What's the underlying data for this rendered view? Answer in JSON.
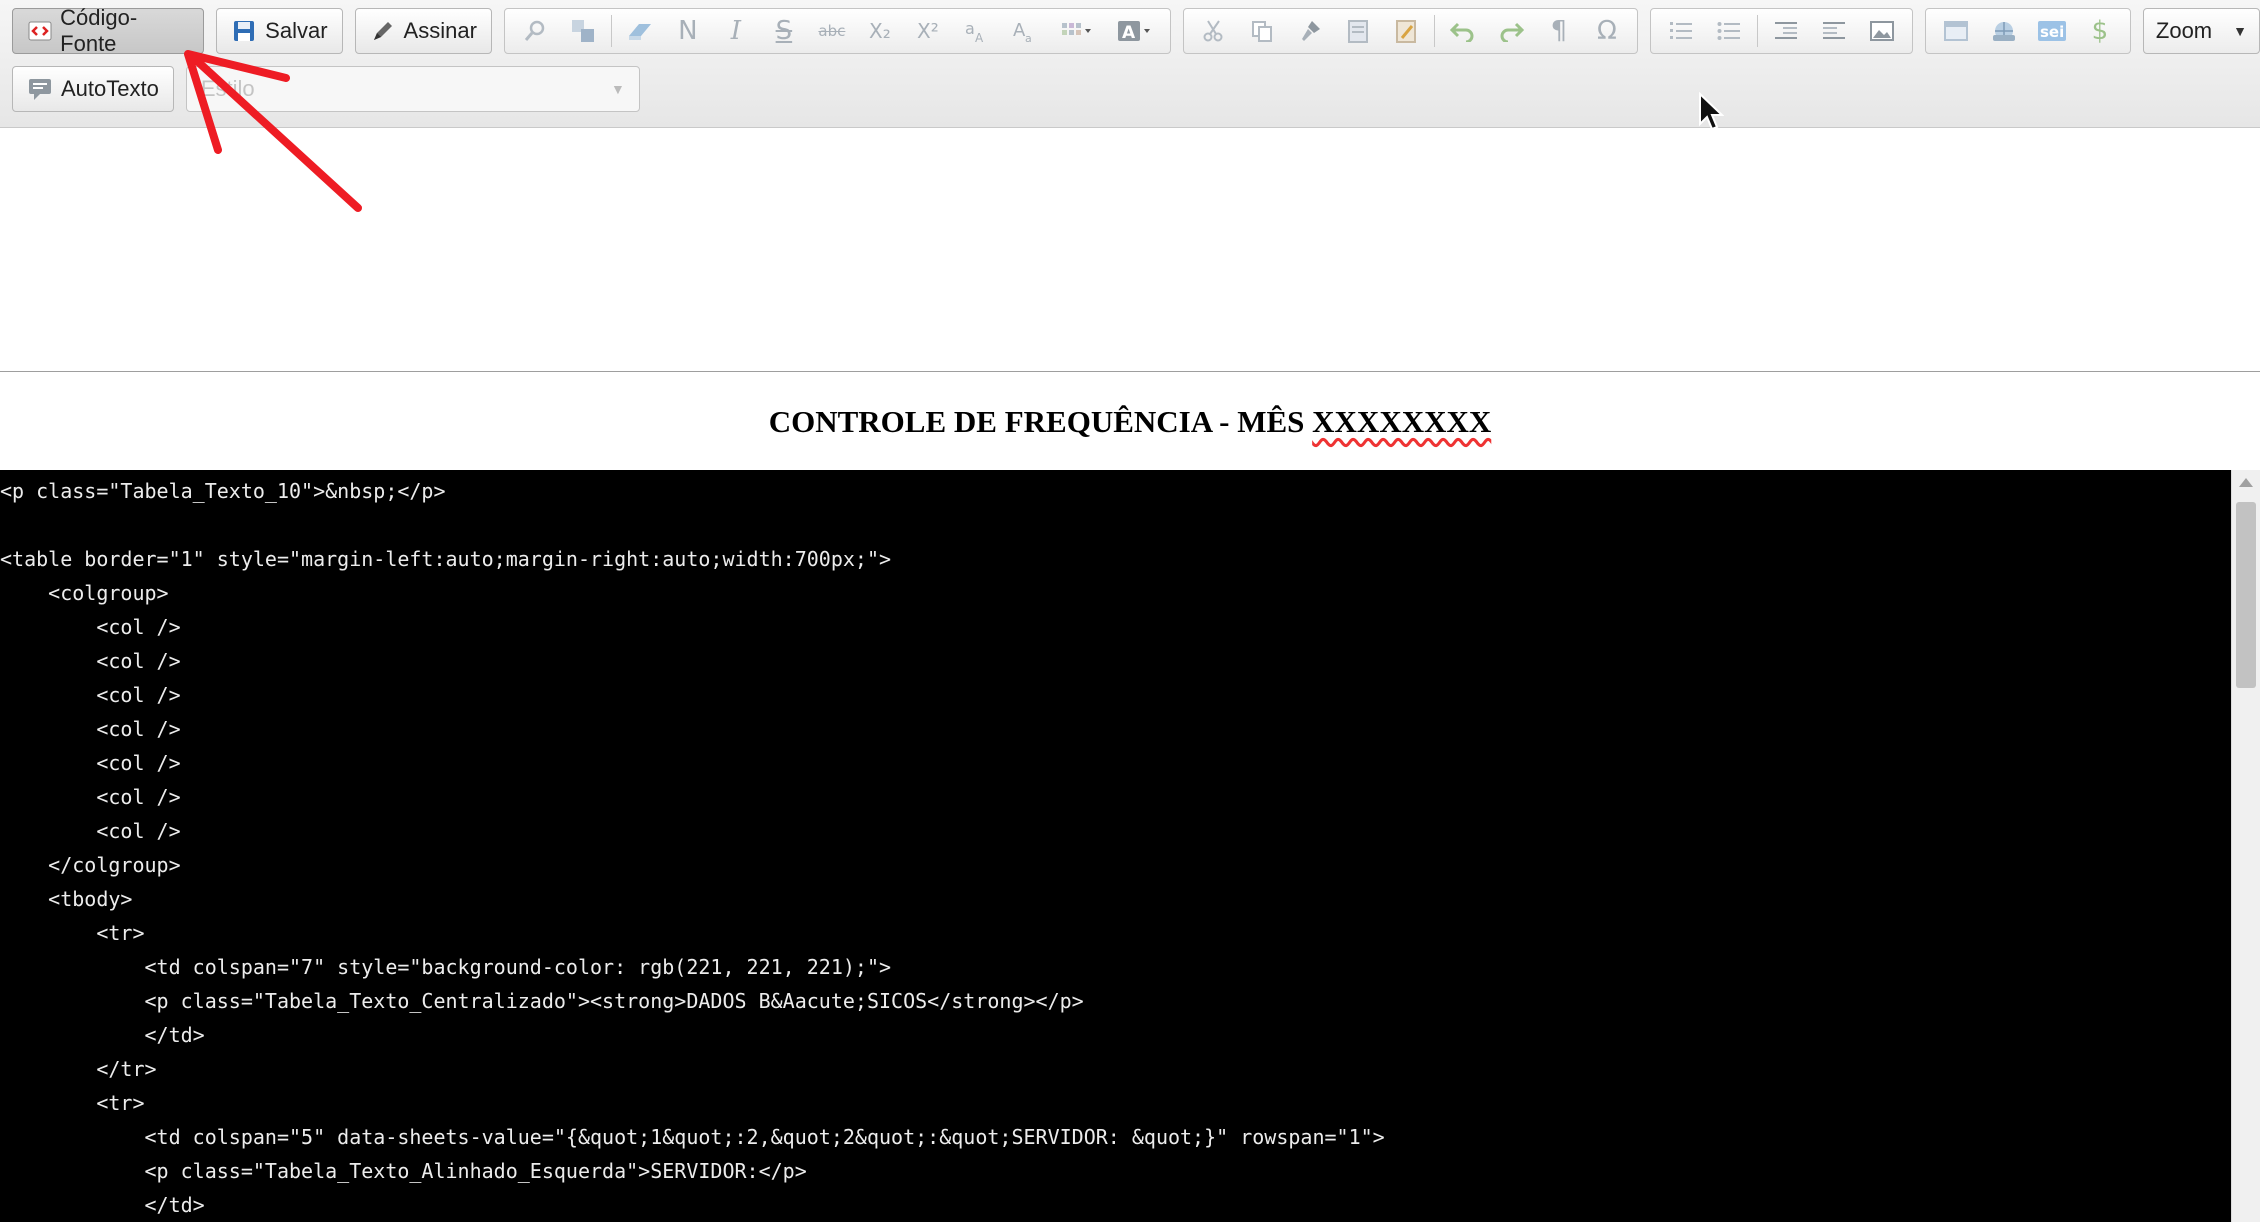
{
  "toolbar": {
    "source_label": "Código-Fonte",
    "save_label": "Salvar",
    "sign_label": "Assinar",
    "autotext_label": "AutoTexto",
    "zoom_label": "Zoom",
    "style_placeholder": "Estilo",
    "format_glyphs": {
      "bold": "N",
      "italic": "I",
      "strike": "S",
      "strike_small": "abc",
      "subscript": "X₂",
      "superscript": "X²",
      "omega": "Ω",
      "pilcrow": "¶",
      "dollar": "$"
    }
  },
  "document": {
    "title_prefix": "CONTROLE DE FREQUÊNCIA - MÊS ",
    "title_placeholder": "XXXXXXXX"
  },
  "source_code": [
    "<p class=\"Tabela_Texto_10\">&nbsp;</p>",
    "",
    "<table border=\"1\" style=\"margin-left:auto;margin-right:auto;width:700px;\">",
    "    <colgroup>",
    "        <col />",
    "        <col />",
    "        <col />",
    "        <col />",
    "        <col />",
    "        <col />",
    "        <col />",
    "    </colgroup>",
    "    <tbody>",
    "        <tr>",
    "            <td colspan=\"7\" style=\"background-color: rgb(221, 221, 221);\">",
    "            <p class=\"Tabela_Texto_Centralizado\"><strong>DADOS B&Aacute;SICOS</strong></p>",
    "            </td>",
    "        </tr>",
    "        <tr>",
    "            <td colspan=\"5\" data-sheets-value=\"{&quot;1&quot;:2,&quot;2&quot;:&quot;SERVIDOR: &quot;}\" rowspan=\"1\">",
    "            <p class=\"Tabela_Texto_Alinhado_Esquerda\">SERVIDOR:</p>",
    "            </td>"
  ],
  "colors": {
    "annotation_arrow": "#ee1c24",
    "code_background": "#000000",
    "code_text": "#ececec",
    "icon_gray": "#a8b0b8"
  }
}
